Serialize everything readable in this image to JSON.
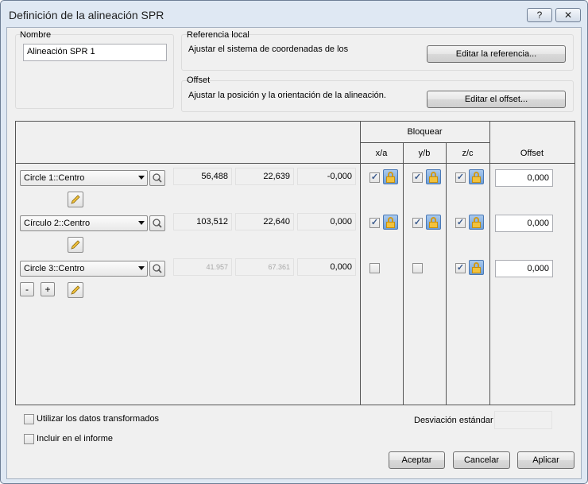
{
  "window": {
    "title": "Definición de la alineación SPR",
    "help_label": "?",
    "close_label": "✕"
  },
  "nombre": {
    "label": "Nombre",
    "value": "Alineación SPR 1"
  },
  "referencia_local": {
    "label": "Referencia local",
    "description": "Ajustar el sistema de coordenadas de los nominales.",
    "button": "Editar la referencia..."
  },
  "offset_group": {
    "label": "Offset",
    "description": "Ajustar la posición y la orientación de la alineación.",
    "button": "Editar el offset..."
  },
  "table": {
    "bloquear_header": "Bloquear",
    "col_xa": "x/a",
    "col_yb": "y/b",
    "col_zc": "z/c",
    "col_offset": "Offset",
    "rows": [
      {
        "element": "Circle 1::Centro",
        "x": "56,488",
        "y": "22,639",
        "z": "-0,000",
        "lock_x": true,
        "lock_y": true,
        "lock_z": true,
        "offset": "0,000",
        "dim_xy": false
      },
      {
        "element": "Círculo 2::Centro",
        "x": "103,512",
        "y": "22,640",
        "z": "0,000",
        "lock_x": true,
        "lock_y": true,
        "lock_z": true,
        "offset": "0,000",
        "dim_xy": false
      },
      {
        "element": "Circle 3::Centro",
        "x": "41.957",
        "y": "67.361",
        "z": "0,000",
        "lock_x": false,
        "lock_y": false,
        "lock_z": true,
        "offset": "0,000",
        "dim_xy": true
      }
    ],
    "minus_label": "-",
    "plus_label": "+"
  },
  "options": {
    "use_transformed": "Utilizar los datos transformados",
    "include_report": "Incluir en el informe",
    "std_dev_label": "Desviación estándar",
    "std_dev_value": ""
  },
  "footer": {
    "accept": "Aceptar",
    "cancel": "Cancelar",
    "apply": "Aplicar"
  },
  "colors": {
    "frame": "#dfe8f3",
    "client": "#f0f0f0",
    "lock_blue": "#6d9fd8",
    "lock_gold": "#f2c23c"
  }
}
